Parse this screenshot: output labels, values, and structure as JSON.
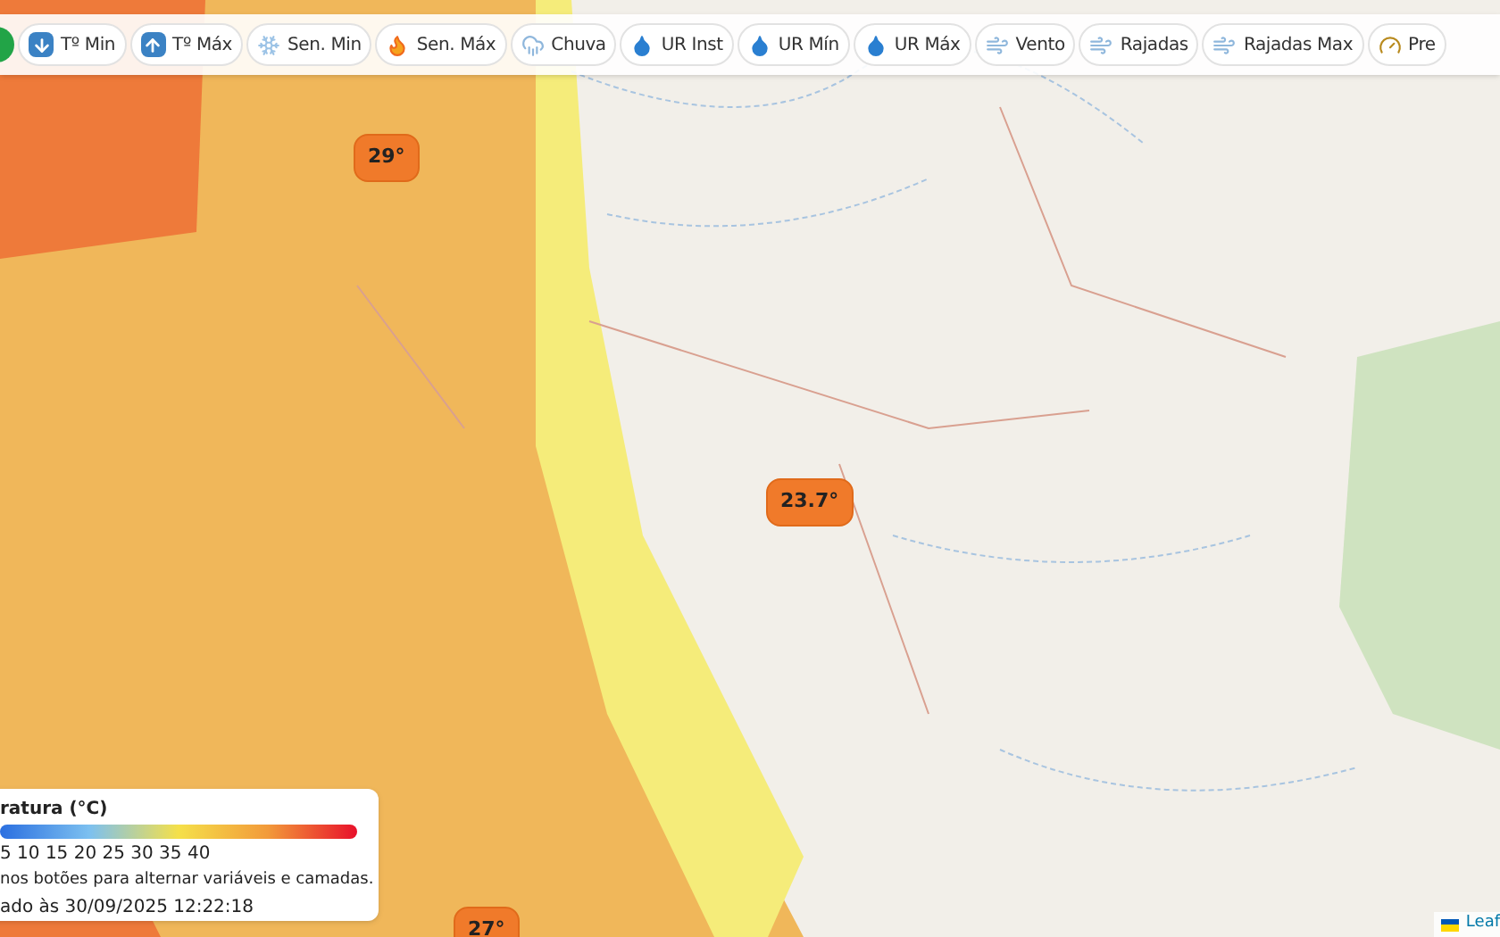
{
  "toolbar": {
    "buttons": [
      {
        "kind": "arrow-down",
        "label": "Tº Min"
      },
      {
        "kind": "arrow-up",
        "label": "Tº Máx"
      },
      {
        "kind": "snow",
        "label": "Sen. Min"
      },
      {
        "kind": "flame",
        "label": "Sen. Máx"
      },
      {
        "kind": "rain",
        "label": "Chuva"
      },
      {
        "kind": "drop",
        "label": "UR Inst"
      },
      {
        "kind": "drop",
        "label": "UR Mín"
      },
      {
        "kind": "drop",
        "label": "UR Máx"
      },
      {
        "kind": "wind",
        "label": "Vento"
      },
      {
        "kind": "wind",
        "label": "Rajadas"
      },
      {
        "kind": "wind",
        "label": "Rajadas Max"
      },
      {
        "kind": "gauge",
        "label": "Pre"
      }
    ]
  },
  "markers": [
    {
      "label": "29°"
    },
    {
      "label": "23.7°"
    },
    {
      "label": "27°"
    }
  ],
  "legend": {
    "title": "ratura (°C)",
    "scale": "5 10 15 20 25 30 35 40",
    "hint": "nos botões para alternar variáveis e camadas.",
    "updated": "ado às 30/09/2025 12:22:18"
  },
  "attribution": "Leaf"
}
